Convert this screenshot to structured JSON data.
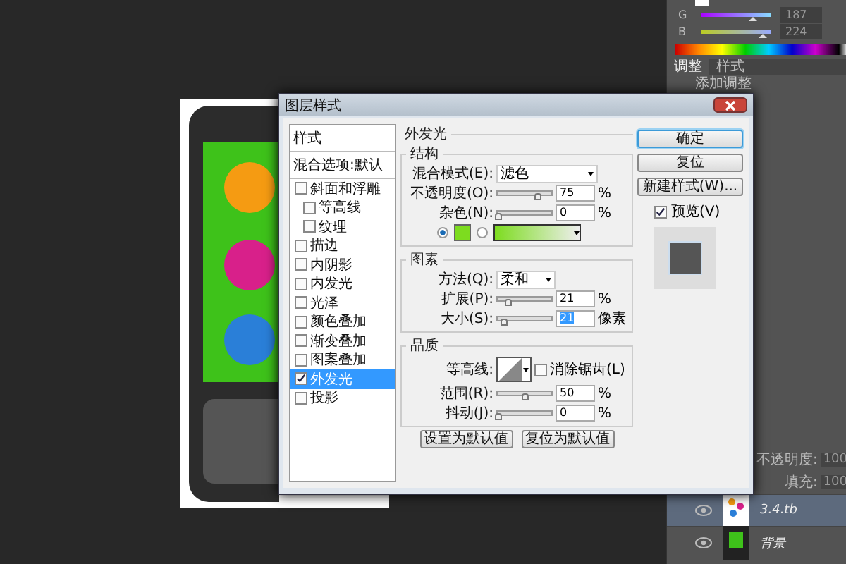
{
  "color_panel": {
    "channels": [
      {
        "name": "G",
        "level": 0.73,
        "value": "187"
      },
      {
        "name": "B",
        "level": 0.88,
        "value": "224"
      }
    ]
  },
  "adjust_panel": {
    "tabs": [
      {
        "label": "调整",
        "selected": true
      },
      {
        "label": "样式",
        "selected": false
      }
    ],
    "hint": "添加调整"
  },
  "layers_panel": {
    "opacity_label": "不透明度:",
    "opacity_value": "100",
    "fill_label": "填充:",
    "fill_value": "100",
    "layers": [
      {
        "name": "3.4.tb",
        "selected": true,
        "kind": "icons"
      },
      {
        "name": "背景",
        "selected": false,
        "kind": "phone"
      }
    ]
  },
  "dialog": {
    "title": "图层样式",
    "styles_header": "样式",
    "blend_options": "混合选项:默认",
    "effects": [
      {
        "label": "斜面和浮雕",
        "checked": false,
        "selected": false,
        "children": [
          {
            "label": "等高线",
            "checked": false,
            "selected": false
          },
          {
            "label": "纹理",
            "checked": false,
            "selected": false
          }
        ]
      },
      {
        "label": "描边",
        "checked": false,
        "selected": false
      },
      {
        "label": "内阴影",
        "checked": false,
        "selected": false
      },
      {
        "label": "内发光",
        "checked": false,
        "selected": false
      },
      {
        "label": "光泽",
        "checked": false,
        "selected": false
      },
      {
        "label": "颜色叠加",
        "checked": false,
        "selected": false
      },
      {
        "label": "渐变叠加",
        "checked": false,
        "selected": false
      },
      {
        "label": "图案叠加",
        "checked": false,
        "selected": false
      },
      {
        "label": "外发光",
        "checked": true,
        "selected": true
      },
      {
        "label": "投影",
        "checked": false,
        "selected": false
      }
    ],
    "panel_title": "外发光",
    "structure": {
      "title": "结构",
      "blend_label": "混合模式(E):",
      "blend_value": "滤色",
      "sliders": [
        {
          "label": "不透明度(O):",
          "level": 0.75,
          "value": "75",
          "unit": "%"
        },
        {
          "label": "杂色(N):",
          "level": 0,
          "value": "0",
          "unit": "%"
        }
      ],
      "fill_modes": [
        {
          "kind": "solid",
          "selected": true
        },
        {
          "kind": "gradient",
          "selected": false
        }
      ]
    },
    "elements": {
      "title": "图素",
      "technique_label": "方法(Q):",
      "technique_value": "柔和",
      "sliders": [
        {
          "label": "扩展(P):",
          "level": 0.21,
          "value": "21",
          "unit": "%",
          "highlighted": false
        },
        {
          "label": "大小(S):",
          "level": 0.12,
          "value": "21",
          "unit": "像素",
          "highlighted": true
        }
      ]
    },
    "quality": {
      "title": "品质",
      "contour_label": "等高线:",
      "anti_alias": {
        "label": "消除锯齿(L)",
        "checked": false
      },
      "sliders": [
        {
          "label": "范围(R):",
          "level": 0.5,
          "value": "50",
          "unit": "%"
        },
        {
          "label": "抖动(J):",
          "level": 0,
          "value": "0",
          "unit": "%"
        }
      ]
    },
    "default_buttons": [
      "设置为默认值",
      "复位为默认值"
    ],
    "actions": [
      {
        "label": "确定",
        "default": true
      },
      {
        "label": "复位",
        "default": false
      },
      {
        "label": "新建样式(W)...",
        "default": false
      }
    ],
    "preview": {
      "label": "预览(V)",
      "checked": true
    }
  }
}
